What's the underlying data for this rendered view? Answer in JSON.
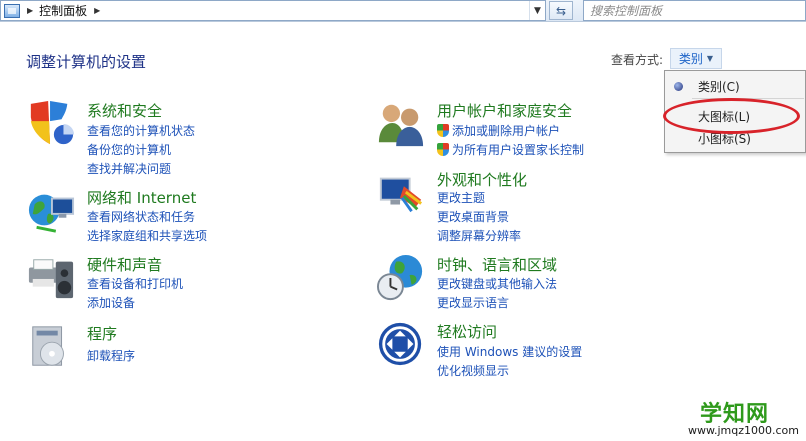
{
  "address_bar": {
    "breadcrumb": "控制面板",
    "search_placeholder": "搜索控制面板"
  },
  "header": {
    "title": "调整计算机的设置",
    "view_by_label": "查看方式:",
    "view_by_value": "类别"
  },
  "view_menu": {
    "items": [
      {
        "label": "类别(C)",
        "selected": true
      },
      {
        "label": "大图标(L)",
        "selected": false
      },
      {
        "label": "小图标(S)",
        "selected": false
      }
    ],
    "highlight_color": "#d8232a"
  },
  "categories": [
    {
      "title": "系统和安全",
      "icon": "system-security-shield-icon",
      "links": [
        "查看您的计算机状态",
        "备份您的计算机",
        "查找并解决问题"
      ]
    },
    {
      "title": "网络和 Internet",
      "icon": "network-globe-icon",
      "links": [
        "查看网络状态和任务",
        "选择家庭组和共享选项"
      ]
    },
    {
      "title": "硬件和声音",
      "icon": "printer-speaker-icon",
      "links": [
        "查看设备和打印机",
        "添加设备"
      ]
    },
    {
      "title": "程序",
      "icon": "programs-disc-icon",
      "links": [
        "卸载程序"
      ]
    },
    {
      "title": "用户帐户和家庭安全",
      "icon": "users-icon",
      "links": [
        "添加或删除用户帐户",
        "为所有用户设置家长控制"
      ]
    },
    {
      "title": "外观和个性化",
      "icon": "monitor-palette-icon",
      "links": [
        "更改主题",
        "更改桌面背景",
        "调整屏幕分辨率"
      ]
    },
    {
      "title": "时钟、语言和区域",
      "icon": "clock-globe-icon",
      "links": [
        "更改键盘或其他输入法",
        "更改显示语言"
      ]
    },
    {
      "title": "轻松访问",
      "icon": "ease-of-access-icon",
      "links": [
        "使用 Windows 建议的设置",
        "优化视频显示"
      ]
    }
  ],
  "watermark": {
    "title": "学知网",
    "url": "www.jmqz1000.com"
  },
  "colors": {
    "category_title": "#1f7a1f",
    "link": "#1e52b8",
    "page_title": "#1e3287"
  }
}
